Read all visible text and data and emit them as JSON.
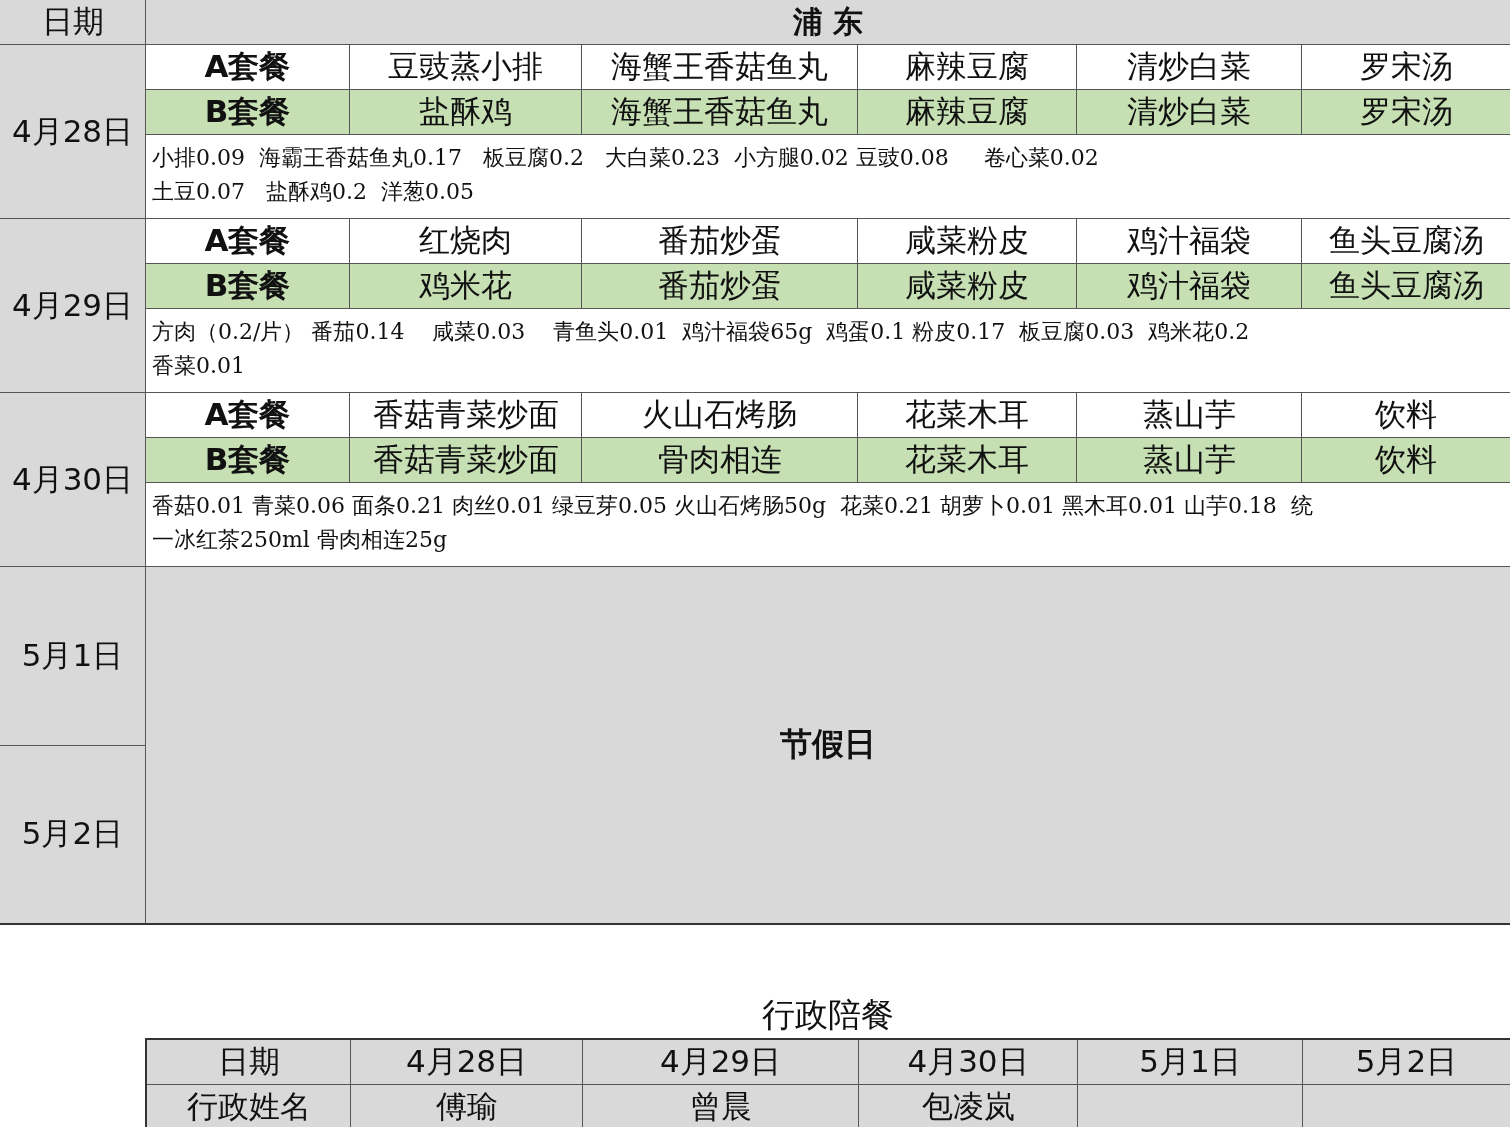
{
  "header": {
    "date_label": "日期",
    "location": "浦 东"
  },
  "days": [
    {
      "date": "4月28日",
      "menus": [
        {
          "label": "A套餐",
          "kind": "a",
          "dishes": [
            "豆豉蒸小排",
            "海蟹王香菇鱼丸",
            "麻辣豆腐",
            "清炒白菜",
            "罗宋汤"
          ]
        },
        {
          "label": "B套餐",
          "kind": "b",
          "dishes": [
            "盐酥鸡",
            "海蟹王香菇鱼丸",
            "麻辣豆腐",
            "清炒白菜",
            "罗宋汤"
          ]
        }
      ],
      "note_lines": [
        "小排0.09  海霸王香菇鱼丸0.17   板豆腐0.2   大白菜0.23  小方腿0.02 豆豉0.08     卷心菜0.02",
        "土豆0.07   盐酥鸡0.2  洋葱0.05"
      ]
    },
    {
      "date": "4月29日",
      "menus": [
        {
          "label": "A套餐",
          "kind": "a",
          "dishes": [
            "红烧肉",
            "番茄炒蛋",
            "咸菜粉皮",
            "鸡汁福袋",
            "鱼头豆腐汤"
          ]
        },
        {
          "label": "B套餐",
          "kind": "b",
          "dishes": [
            "鸡米花",
            "番茄炒蛋",
            "咸菜粉皮",
            "鸡汁福袋",
            "鱼头豆腐汤"
          ]
        }
      ],
      "note_lines": [
        "方肉（0.2/片） 番茄0.14    咸菜0.03    青鱼头0.01  鸡汁福袋65g  鸡蛋0.1 粉皮0.17  板豆腐0.03  鸡米花0.2",
        "香菜0.01"
      ]
    },
    {
      "date": "4月30日",
      "menus": [
        {
          "label": "A套餐",
          "kind": "a",
          "dishes": [
            "香菇青菜炒面",
            "火山石烤肠",
            "花菜木耳",
            "蒸山芋",
            "饮料"
          ]
        },
        {
          "label": "B套餐",
          "kind": "b",
          "dishes": [
            "香菇青菜炒面",
            "骨肉相连",
            "花菜木耳",
            "蒸山芋",
            "饮料"
          ]
        }
      ],
      "note_lines": [
        "香菇0.01 青菜0.06 面条0.21 肉丝0.01 绿豆芽0.05 火山石烤肠50g  花菜0.21 胡萝卜0.01 黑木耳0.01 山芋0.18  统",
        "一冰红茶250ml 骨肉相连25g"
      ]
    }
  ],
  "holiday": {
    "dates": [
      "5月1日",
      "5月2日"
    ],
    "label": "节假日"
  },
  "executive": {
    "title": "行政陪餐",
    "header_label": "日期",
    "dates": [
      "4月28日",
      "4月29日",
      "4月30日",
      "5月1日",
      "5月2日"
    ],
    "name_label": "行政姓名",
    "names": [
      "傅瑜",
      "曾晨",
      "包凌岚"
    ]
  }
}
